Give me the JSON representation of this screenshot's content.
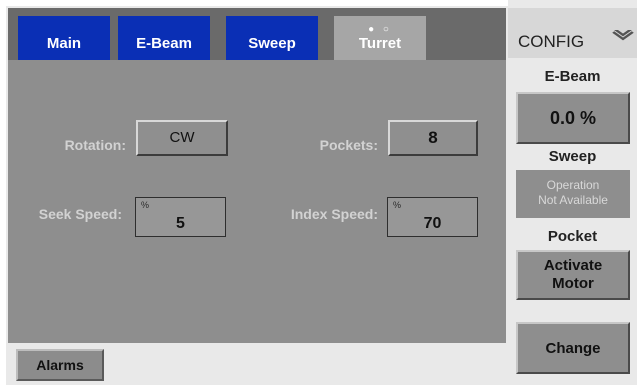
{
  "tabs": [
    {
      "label": "Main"
    },
    {
      "label": "E-Beam"
    },
    {
      "label": "Sweep"
    },
    {
      "label": "Turret",
      "pager_dots": "● ○"
    }
  ],
  "turret": {
    "rotation": {
      "label": "Rotation:",
      "value": "CW"
    },
    "pockets": {
      "label": "Pockets:",
      "value": "8"
    },
    "seek_speed": {
      "label": "Seek Speed:",
      "unit": "%",
      "value": "5"
    },
    "index_speed": {
      "label": "Index Speed:",
      "unit": "%",
      "value": "70"
    }
  },
  "bottom": {
    "alarms_label": "Alarms"
  },
  "right_panel": {
    "config_label": "CONFIG",
    "ebeam_label": "E-Beam",
    "ebeam_value": "0.0 %",
    "sweep_label": "Sweep",
    "sweep_status_line1": "Operation",
    "sweep_status_line2": "Not Available",
    "pocket_label": "Pocket",
    "activate_line1": "Activate",
    "activate_line2": "Motor",
    "change_label": "Change"
  },
  "colors": {
    "tab_blue": "#0a2fb5",
    "tab_active": "#a6a6a6",
    "panel_gray": "#8e8e8e"
  },
  "icons": {
    "config_toggle": "chevron-down-icon"
  }
}
